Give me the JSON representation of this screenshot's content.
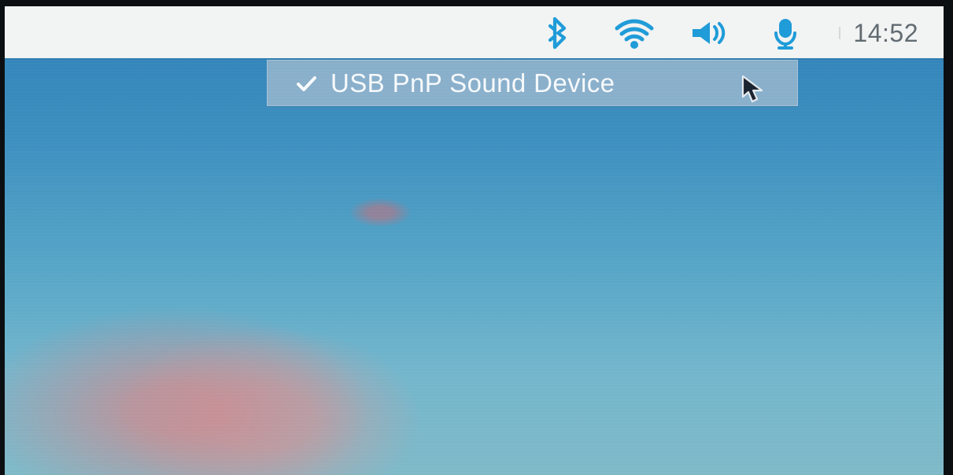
{
  "taskbar": {
    "tray_icons": [
      {
        "name": "bluetooth-icon",
        "color": "#1e9bd8"
      },
      {
        "name": "wifi-icon",
        "color": "#1e9bd8"
      },
      {
        "name": "volume-icon",
        "color": "#1e9bd8"
      },
      {
        "name": "microphone-icon",
        "color": "#1e9bd8"
      }
    ],
    "clock": "14:52"
  },
  "audio_menu": {
    "items": [
      {
        "label": "USB PnP Sound Device",
        "selected": true,
        "check_icon": "check-icon"
      }
    ]
  },
  "cursor": {
    "icon": "mouse-pointer-icon"
  }
}
